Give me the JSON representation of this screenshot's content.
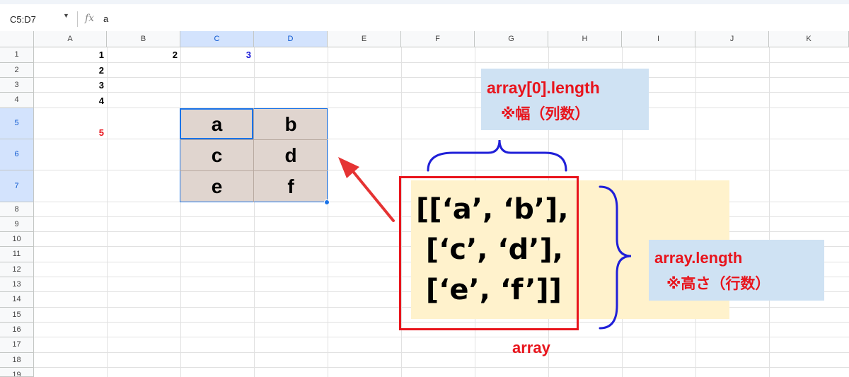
{
  "formula_bar": {
    "name_box": "C5:D7",
    "fx": "fx",
    "formula": "a"
  },
  "columns": [
    "A",
    "B",
    "C",
    "D",
    "E",
    "F",
    "G",
    "H",
    "I",
    "J",
    "K"
  ],
  "rows": [
    "1",
    "2",
    "3",
    "4",
    "5",
    "6",
    "7",
    "8",
    "9",
    "10",
    "11",
    "12",
    "13",
    "14",
    "15",
    "16",
    "17",
    "18",
    "19"
  ],
  "cells": {
    "A1": "1",
    "A2": "2",
    "A3": "3",
    "A4": "4",
    "A5": "5",
    "B1": "2",
    "C1": "3",
    "C5": "a",
    "D5": "b",
    "C6": "c",
    "D6": "d",
    "C7": "e",
    "D7": "f"
  },
  "annotations": {
    "width_label_line1": "array[0].length",
    "width_label_line2": "※幅（列数）",
    "height_label_line1": "array.length",
    "height_label_line2": "※高さ（行数）",
    "array_lines": [
      "[[‘a’, ‘b’],",
      " [‘c’, ‘d’],",
      " [‘e’, ‘f’]]"
    ],
    "array_label": "array"
  },
  "colors": {
    "selection_blue": "#1a73e8",
    "header_selected_bg": "#d3e3fd",
    "range_fill": "#e0d5cf",
    "annotation_red": "#e8141c",
    "note_blue_bg": "#cfe2f3",
    "cream_bg": "#fff2cc",
    "brace_blue": "#1f1fd8",
    "cell_blue_text": "#1a1ad8",
    "cell_red_text": "#e8141c"
  }
}
